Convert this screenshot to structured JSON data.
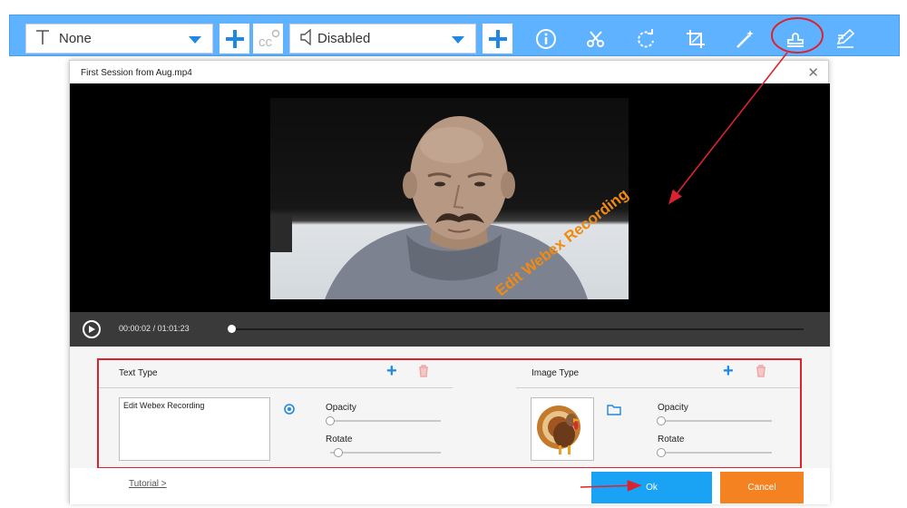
{
  "toolbar": {
    "subtitle_dropdown": {
      "value": "None",
      "icon": "text-t-icon"
    },
    "audio_dropdown": {
      "value": "Disabled",
      "icon": "speaker-icon"
    },
    "icons": [
      "info-icon",
      "scissors-icon",
      "rotate-icon",
      "crop-icon",
      "magic-wand-icon",
      "watermark-stamp-icon",
      "edit-subtitle-icon"
    ],
    "accent_color": "#5fb2ff"
  },
  "dialog": {
    "title": "First Session from Aug.mp4",
    "close_label": "✕"
  },
  "player": {
    "current_time": "00:00:02",
    "separator": "/",
    "total_time": "01:01:23",
    "progress_fraction": 0.003,
    "watermark_text": "Edit Webex Recording",
    "watermark_color": "#f08a12"
  },
  "watermark_panel": {
    "text_type": {
      "label": "Text Type",
      "text_value": "Edit Webex Recording",
      "opacity_label": "Opacity",
      "rotate_label": "Rotate",
      "opacity_level": 0.0,
      "rotate_level": 0.07
    },
    "image_type": {
      "label": "Image Type",
      "opacity_label": "Opacity",
      "rotate_label": "Rotate",
      "opacity_level": 0.0,
      "rotate_level": 0.0,
      "image_icon": "turkey-image"
    },
    "highlight_color": "#d9242f"
  },
  "footer": {
    "tutorial_link": "Tutorial >",
    "ok_label": "Ok",
    "cancel_label": "Cancel",
    "ok_color": "#1aa3f4",
    "cancel_color": "#f58220"
  }
}
